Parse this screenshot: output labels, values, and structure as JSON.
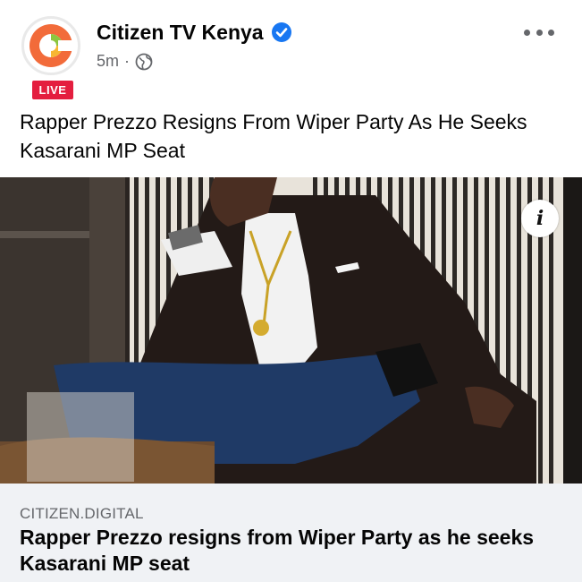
{
  "post": {
    "page_name": "Citizen TV Kenya",
    "live_badge": "LIVE",
    "time": "5m",
    "separator": "·",
    "text": "Rapper Prezzo Resigns From Wiper Party As He Seeks Kasarani MP Seat",
    "icons": {
      "verified": "verified-badge-icon",
      "audience": "globe-icon",
      "more": "more-options-icon",
      "info": "info-icon"
    }
  },
  "link_card": {
    "domain": "CITIZEN.DIGITAL",
    "title": "Rapper Prezzo resigns from Wiper Party as he seeks Kasarani MP seat"
  },
  "colors": {
    "live_red": "#e41e3f",
    "verified_blue": "#1877f2",
    "meta_gray": "#65676b",
    "card_bg": "#f0f2f5"
  }
}
